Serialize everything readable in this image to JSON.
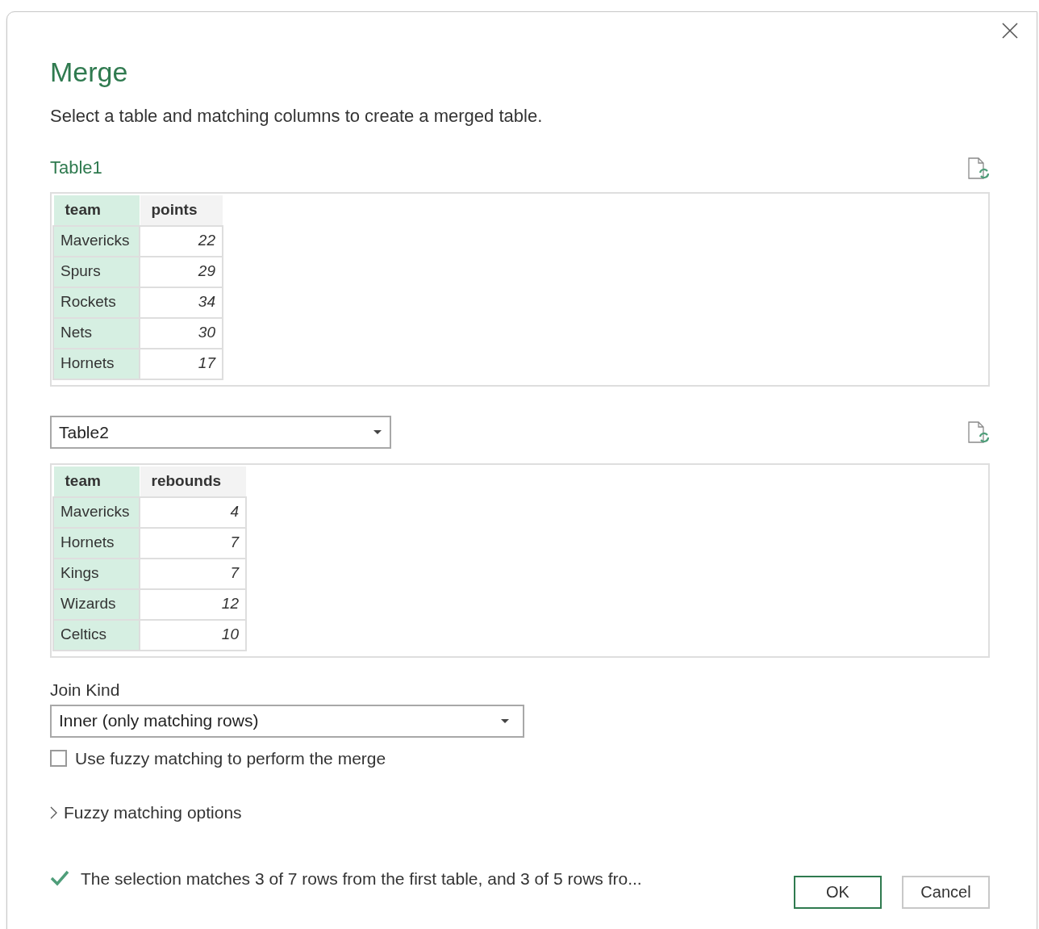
{
  "dialog": {
    "title": "Merge",
    "subtitle": "Select a table and matching columns to create a merged table."
  },
  "first_table": {
    "name": "Table1",
    "columns": [
      {
        "label": "team",
        "selected": true,
        "kind": "text"
      },
      {
        "label": "points",
        "selected": false,
        "kind": "number"
      }
    ],
    "rows": [
      [
        "Mavericks",
        "22"
      ],
      [
        "Spurs",
        "29"
      ],
      [
        "Rockets",
        "34"
      ],
      [
        "Nets",
        "30"
      ],
      [
        "Hornets",
        "17"
      ]
    ]
  },
  "second_table": {
    "dropdown": "Table2",
    "columns": [
      {
        "label": "team",
        "selected": true,
        "kind": "text"
      },
      {
        "label": "rebounds",
        "selected": false,
        "kind": "number"
      }
    ],
    "rows": [
      [
        "Mavericks",
        "4"
      ],
      [
        "Hornets",
        "7"
      ],
      [
        "Kings",
        "7"
      ],
      [
        "Wizards",
        "12"
      ],
      [
        "Celtics",
        "10"
      ]
    ]
  },
  "join_kind": {
    "label": "Join Kind",
    "value": "Inner (only matching rows)"
  },
  "fuzzy": {
    "label": "Use fuzzy matching to perform the merge",
    "checked": false
  },
  "fuzzy_options": {
    "label": "Fuzzy matching options",
    "expanded": false
  },
  "status": "The selection matches 3 of 7 rows from the first table, and 3 of 5 rows fro...",
  "buttons": [
    {
      "label": "OK",
      "kind": "primary"
    },
    {
      "label": "Cancel",
      "kind": "secondary"
    }
  ]
}
